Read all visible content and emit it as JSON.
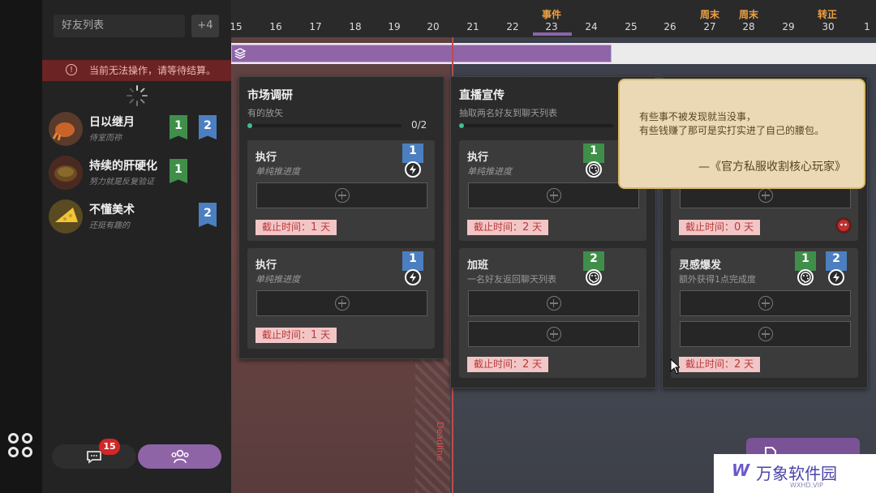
{
  "friend_panel": {
    "search_placeholder": "好友列表",
    "more_count": "+4",
    "warning": "当前无法操作，请等待结算。",
    "friends": [
      {
        "name": "日以继月",
        "subtitle": "侍室而祢",
        "badges": [
          "1",
          "2"
        ]
      },
      {
        "name": "持续的肝硬化",
        "subtitle": "努力就是反复验证",
        "badges": [
          "1"
        ]
      },
      {
        "name": "不懂美术",
        "subtitle": "还挺有趣的",
        "badges": [
          "2"
        ]
      }
    ],
    "chat_count": "15"
  },
  "timeline": {
    "days": [
      "15",
      "16",
      "17",
      "18",
      "19",
      "20",
      "21",
      "22",
      "23",
      "24",
      "25",
      "26",
      "27",
      "28",
      "29",
      "30",
      "1"
    ],
    "events": {
      "e23": "事件",
      "e27": "周末",
      "e28": "周末",
      "e30": "转正"
    }
  },
  "projects": [
    {
      "title": "市场调研",
      "subtitle": "有的放矢",
      "progress_text": "0/2",
      "tasks": [
        {
          "name": "执行",
          "sub": "单纯推进度",
          "deadline_label": "截止时间：",
          "deadline_days": "1",
          "deadline_unit": "天",
          "badge": "1"
        },
        {
          "name": "执行",
          "sub": "单纯推进度",
          "deadline_label": "截止时间：",
          "deadline_days": "1",
          "deadline_unit": "天",
          "badge": "1"
        }
      ]
    },
    {
      "title": "直播宣传",
      "subtitle": "抽取两名好友到聊天列表",
      "tasks": [
        {
          "name": "执行",
          "sub": "单纯推进度",
          "deadline_label": "截止时间：",
          "deadline_days": "2",
          "deadline_unit": "天",
          "badge": "1"
        },
        {
          "name": "加班",
          "sub": "一名好友返回聊天列表",
          "deadline_label": "截止时间：",
          "deadline_days": "2",
          "deadline_unit": "天",
          "badge": "2"
        }
      ]
    },
    {
      "tasks": [
        {
          "deadline_label": "截止时间：",
          "deadline_days": "0",
          "deadline_unit": "天"
        },
        {
          "name": "灵感爆发",
          "sub": "额外获得1点完成度",
          "deadline_label": "截止时间：",
          "deadline_days": "2",
          "deadline_unit": "天",
          "badges": [
            "1",
            "2"
          ]
        }
      ]
    }
  ],
  "quote": {
    "line1": "有些事不被发现就当没事，",
    "line2": "有些钱赚了那可是实打实进了自己的腰包。",
    "source": "—《官方私服收割核心玩家》"
  },
  "deadline_marker": "Deadline",
  "watermark": {
    "logo": "W",
    "text": "万象软件园",
    "sub": "WXHD.VIP"
  },
  "colors": {
    "accent_purple": "#8f65a8",
    "deadline_red": "#c04a4a",
    "badge_green": "#3f8f4a",
    "badge_blue": "#4c7fbf"
  }
}
